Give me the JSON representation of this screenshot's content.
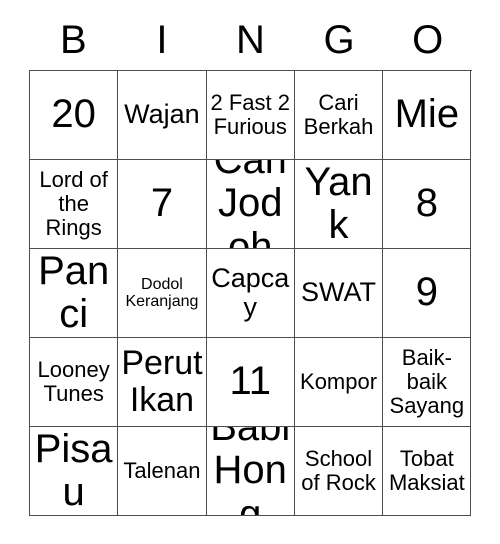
{
  "card": {
    "title": "BINGO",
    "headers": [
      "B",
      "I",
      "N",
      "G",
      "O"
    ],
    "rows": [
      [
        {
          "text": "20",
          "size": "fs-xxl"
        },
        {
          "text": "Wajan",
          "size": "fs-l"
        },
        {
          "text": "2 Fast 2 Furious",
          "size": "fs-m"
        },
        {
          "text": "Cari Berkah",
          "size": "fs-m"
        },
        {
          "text": "Mie",
          "size": "fs-xxl"
        }
      ],
      [
        {
          "text": "Lord of the Rings",
          "size": "fs-m"
        },
        {
          "text": "7",
          "size": "fs-xxl"
        },
        {
          "text": "Cari Jodoh",
          "size": "fs-xxl"
        },
        {
          "text": "Yank",
          "size": "fs-xxl"
        },
        {
          "text": "8",
          "size": "fs-xxl"
        }
      ],
      [
        {
          "text": "Panci",
          "size": "fs-xxl"
        },
        {
          "text": "Dodol Keranjang",
          "size": "fs-s"
        },
        {
          "text": "Capcay",
          "size": "fs-l"
        },
        {
          "text": "SWAT",
          "size": "fs-l"
        },
        {
          "text": "9",
          "size": "fs-xxl"
        }
      ],
      [
        {
          "text": "Looney Tunes",
          "size": "fs-m"
        },
        {
          "text": "Perut Ikan",
          "size": "fs-xl"
        },
        {
          "text": "11",
          "size": "fs-xxl"
        },
        {
          "text": "Kompor",
          "size": "fs-m"
        },
        {
          "text": "Baik-baik Sayang",
          "size": "fs-m"
        }
      ],
      [
        {
          "text": "Pisau",
          "size": "fs-xxl"
        },
        {
          "text": "Talenan",
          "size": "fs-m"
        },
        {
          "text": "Babi Hong",
          "size": "fs-xxl"
        },
        {
          "text": "School of Rock",
          "size": "fs-m"
        },
        {
          "text": "Tobat Maksiat",
          "size": "fs-m"
        }
      ]
    ]
  },
  "colors": {
    "border": "#4d4d4d",
    "text": "#000000",
    "background": "#ffffff"
  }
}
